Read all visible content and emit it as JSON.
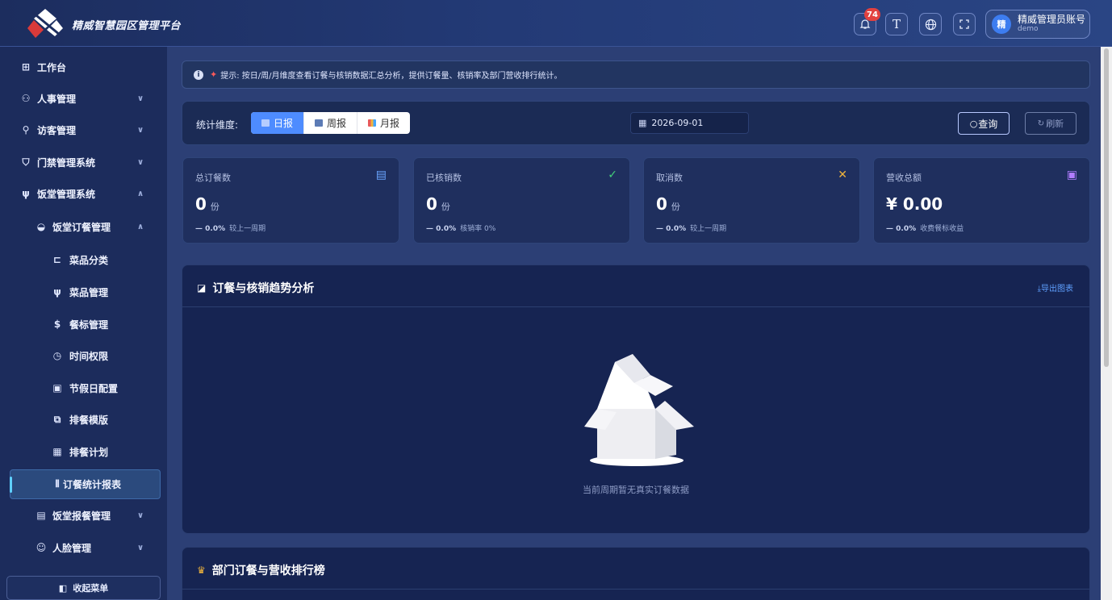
{
  "header": {
    "brand": "精威智慧园区管理平台",
    "notification_count": "74",
    "font_button": "T",
    "user_name": "精威管理员账号",
    "user_sub": "demo",
    "avatar_text": "精"
  },
  "sidebar": {
    "items": [
      {
        "label": "工作台",
        "icon": "grid-icon"
      },
      {
        "label": "人事管理",
        "icon": "people-icon",
        "chevron": "∨"
      },
      {
        "label": "访客管理",
        "icon": "visitor-icon",
        "chevron": "∨"
      },
      {
        "label": "门禁管理系统",
        "icon": "shield-icon",
        "chevron": "∨"
      },
      {
        "label": "饭堂管理系统",
        "icon": "fork-knife-icon",
        "chevron": "∧"
      },
      {
        "label": "饭堂订餐管理",
        "icon": "bowl-icon",
        "chevron": "∧"
      },
      {
        "label": "菜品分类",
        "icon": "category-icon"
      },
      {
        "label": "菜品管理",
        "icon": "fork-knife-icon"
      },
      {
        "label": "餐标管理",
        "icon": "dollar-circle-icon"
      },
      {
        "label": "时间权限",
        "icon": "clock-icon"
      },
      {
        "label": "节假日配置",
        "icon": "calendar-check-icon"
      },
      {
        "label": "排餐模版",
        "icon": "template-icon"
      },
      {
        "label": "排餐计划",
        "icon": "calendar-icon"
      },
      {
        "label": "订餐统计报表",
        "icon": "bar-chart-icon"
      },
      {
        "label": "饭堂报餐管理",
        "icon": "clipboard-icon",
        "chevron": "∨"
      },
      {
        "label": "人脸管理",
        "icon": "face-scan-icon",
        "chevron": "∨"
      }
    ],
    "collapse_label": "收起菜单"
  },
  "tip": {
    "text": "提示: 按日/周/月维度查看订餐与核销数据汇总分析，提供订餐量、核销率及部门营收排行统计。"
  },
  "filter": {
    "label": "统计维度:",
    "segments": [
      "日报",
      "周报",
      "月报"
    ],
    "date": "2026-09-01",
    "query_label": "查询",
    "refresh_label": "刷新"
  },
  "stats": [
    {
      "title": "总订餐数",
      "value": "0",
      "unit": "份",
      "change": "— 0.0%",
      "note": "较上一周期",
      "icon": "document-icon",
      "color": "#6aa5ff"
    },
    {
      "title": "已核销数",
      "value": "0",
      "unit": "份",
      "change": "— 0.0%",
      "note": "核销率 0%",
      "icon": "check-icon",
      "color": "#43d17a"
    },
    {
      "title": "取消数",
      "value": "0",
      "unit": "份",
      "change": "— 0.0%",
      "note": "较上一周期",
      "icon": "close-icon",
      "color": "#f0b43c"
    },
    {
      "title": "营收总额",
      "value": "¥ 0.00",
      "unit": "",
      "change": "— 0.0%",
      "note": "收费餐标收益",
      "icon": "wallet-icon",
      "color": "#b07cff"
    }
  ],
  "trend_panel": {
    "title": "订餐与核销趋势分析",
    "export_label": "导出图表",
    "empty_text": "当前周期暂无真实订餐数据"
  },
  "rank_panel": {
    "title": "部门订餐与营收排行榜"
  }
}
